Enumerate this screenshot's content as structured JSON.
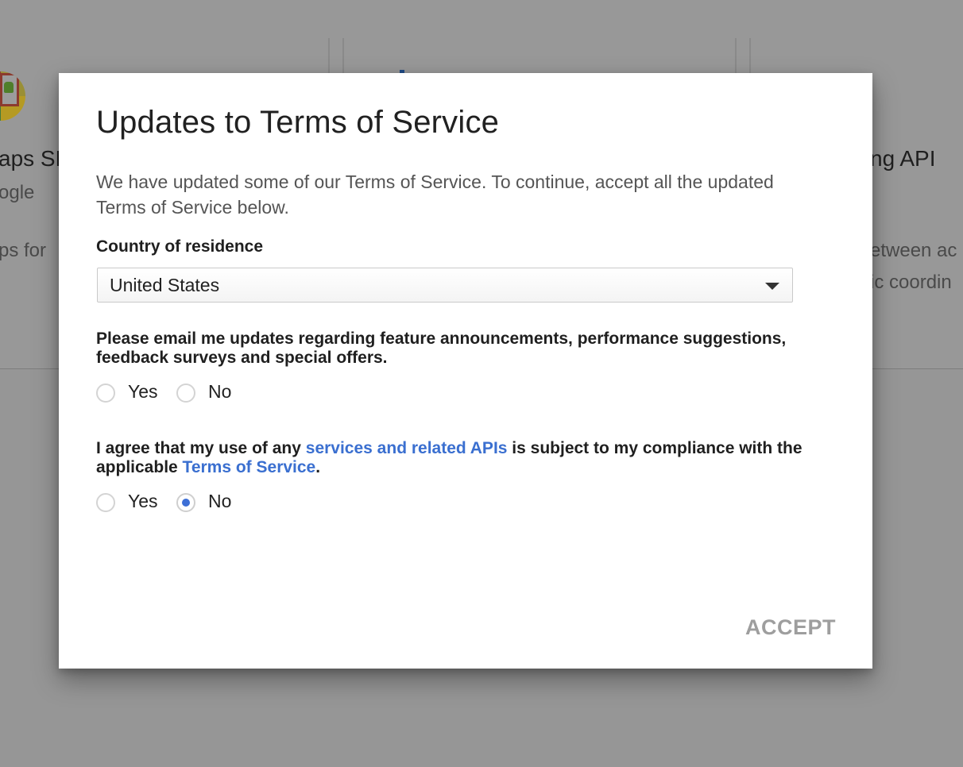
{
  "background": {
    "cards": [
      {
        "title_fragment": "aps SD",
        "sub_fragment": "ogle",
        "desc_fragment": "ps for"
      },
      {
        "title_fragment": "ng API",
        "desc_line1_fragment": "etween ac",
        "desc_line2_fragment": "ic coordin"
      }
    ]
  },
  "dialog": {
    "title": "Updates to Terms of Service",
    "intro": "We have updated some of our Terms of Service. To continue, accept all the updated Terms of Service below.",
    "country": {
      "label": "Country of residence",
      "selected": "United States"
    },
    "email_question": {
      "text": "Please email me updates regarding feature announcements, performance suggestions, feedback surveys and special offers.",
      "options": [
        "Yes",
        "No"
      ],
      "selected": null
    },
    "agreement_question": {
      "text_before": "I agree that my use of any ",
      "link1": "services and related APIs",
      "text_middle": " is subject to my compliance with the applicable ",
      "link2": "Terms of Service",
      "text_after": ".",
      "options": [
        "Yes",
        "No"
      ],
      "selected": "No"
    },
    "accept_label": "ACCEPT"
  },
  "colors": {
    "link": "#3a6fd0",
    "radio_selected": "#3d6fd6",
    "accept_disabled": "#9e9e9e",
    "overlay": "#969696"
  }
}
